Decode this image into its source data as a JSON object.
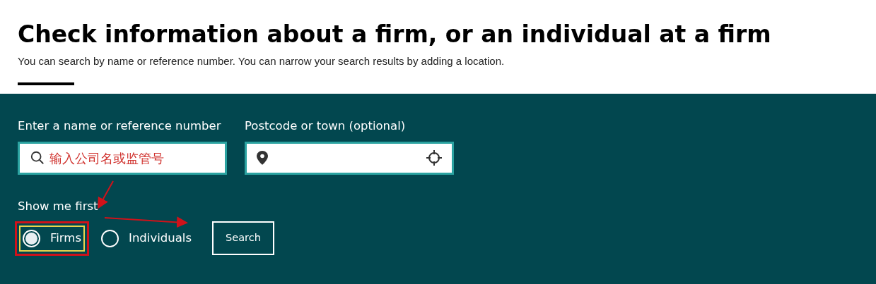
{
  "heading": {
    "title": "Check information about a firm, or an individual at a firm",
    "subtitle": "You can search by name or reference number. You can narrow your search results by adding a location."
  },
  "search": {
    "fields": [
      {
        "kind": "name",
        "label": "Enter a name or reference number",
        "value": "输入公司名或监管号"
      },
      {
        "kind": "location",
        "label": "Postcode or town (optional)"
      }
    ],
    "show_me_first": "Show me first",
    "options": [
      {
        "label": "Firms",
        "selected": true
      },
      {
        "label": "Individuals",
        "selected": false
      }
    ],
    "button": "Search"
  }
}
